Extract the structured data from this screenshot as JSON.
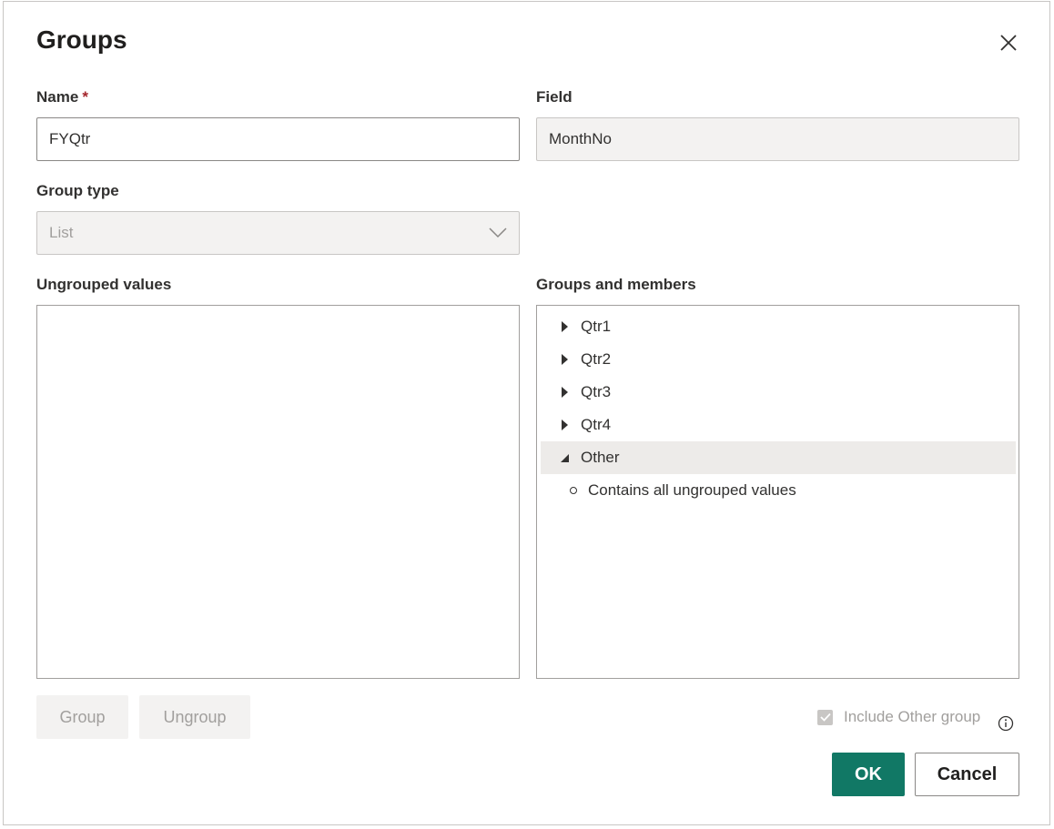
{
  "dialog": {
    "title": "Groups",
    "close_icon": "close-icon"
  },
  "name": {
    "label": "Name",
    "required_mark": "*",
    "value": "FYQtr"
  },
  "field": {
    "label": "Field",
    "value": "MonthNo"
  },
  "group_type": {
    "label": "Group type",
    "selected": "List",
    "icon": "chevron-down-icon"
  },
  "ungrouped": {
    "label": "Ungrouped values",
    "items": []
  },
  "groups_members": {
    "label": "Groups and members",
    "groups": [
      {
        "label": "Qtr1",
        "expanded": false
      },
      {
        "label": "Qtr2",
        "expanded": false
      },
      {
        "label": "Qtr3",
        "expanded": false
      },
      {
        "label": "Qtr4",
        "expanded": false
      },
      {
        "label": "Other",
        "expanded": true
      }
    ],
    "other_member": "Contains all ungrouped values"
  },
  "buttons": {
    "group": "Group",
    "ungroup": "Ungroup",
    "ok": "OK",
    "cancel": "Cancel"
  },
  "include_other": {
    "label": "Include Other group",
    "checked": true,
    "info_icon": "info-icon"
  },
  "colors": {
    "primary": "#117865",
    "selected_row": "#edebe9",
    "required": "#a4262c"
  }
}
